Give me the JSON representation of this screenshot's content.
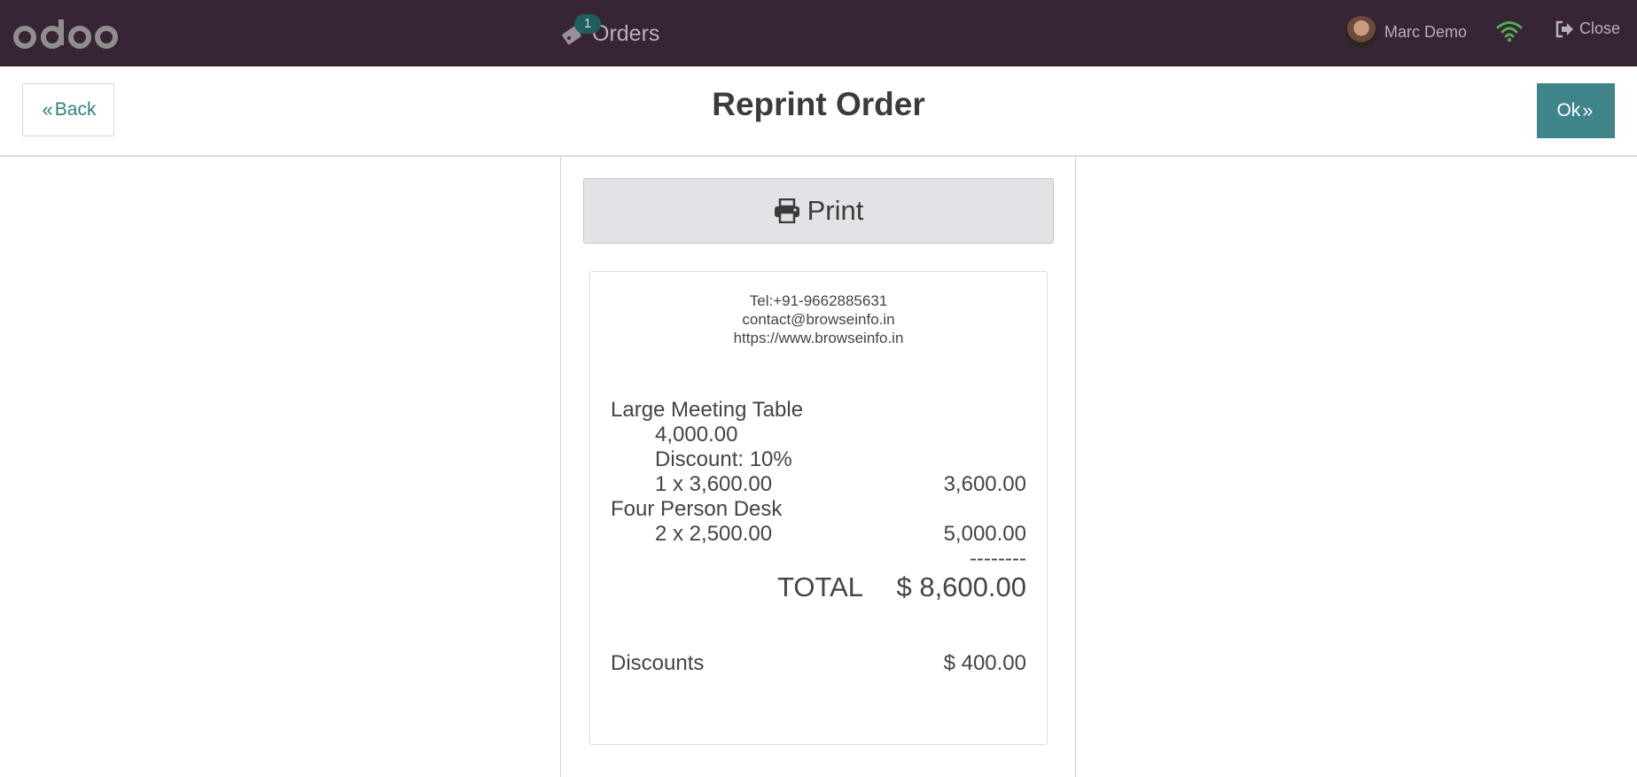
{
  "navbar": {
    "logo_text": "odoo",
    "orders_label": "Orders",
    "orders_badge": "1",
    "user_name": "Marc Demo",
    "close_label": "Close",
    "colors": {
      "background": "#372435",
      "wifi": "#4caf50"
    }
  },
  "controlbar": {
    "back_label": "Back",
    "title": "Reprint Order",
    "ok_label": "Ok",
    "colors": {
      "ok_background": "#3f8489",
      "back_text": "#2f7f7f"
    }
  },
  "print_button": {
    "label": "Print"
  },
  "receipt": {
    "phone": "Tel:+91-9662885631",
    "email": "contact@browseinfo.in",
    "website": "https://www.browseinfo.in",
    "lines": [
      {
        "product": "Large Meeting Table",
        "unit_price": "4,000.00",
        "discount": "Discount: 10%",
        "qty_price": "1 x 3,600.00",
        "subtotal": "3,600.00"
      },
      {
        "product": "Four Person Desk",
        "qty_price": "2 x 2,500.00",
        "subtotal": "5,000.00"
      }
    ],
    "separator": "--------",
    "total_label": "TOTAL",
    "total_value": "$ 8,600.00",
    "discounts_label": "Discounts",
    "discounts_value": "$ 400.00"
  }
}
